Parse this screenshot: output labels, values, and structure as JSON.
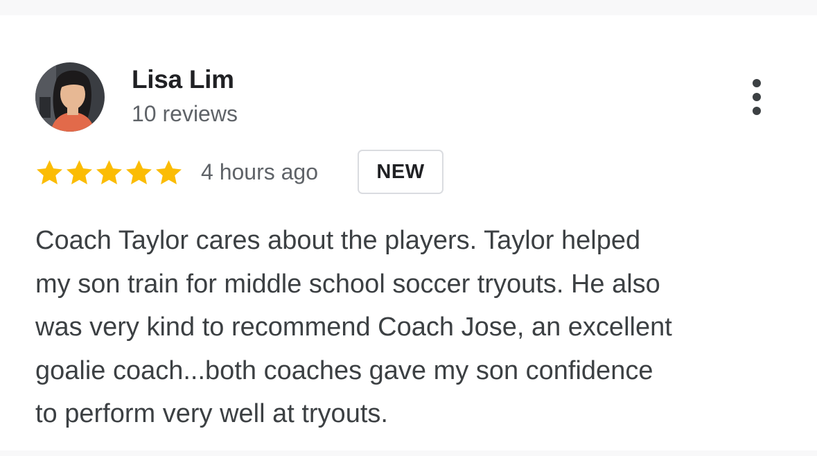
{
  "review": {
    "author": {
      "name": "Lisa Lim",
      "review_count": "10 reviews",
      "avatar_icon": "profile-photo"
    },
    "rating": 5,
    "max_rating": 5,
    "time_ago": "4 hours ago",
    "badge": "NEW",
    "text_lines": [
      "Coach Taylor cares about the players. Taylor helped",
      "my son train for middle school soccer tryouts. He also",
      "was very kind to recommend Coach Jose, an excellent",
      "goalie coach...both coaches gave my son confidence",
      "to perform very well at tryouts."
    ],
    "more_icon": "more-vert-icon"
  },
  "colors": {
    "star": "#fbbc04",
    "name": "#202124",
    "secondary": "#5f6368",
    "body_text": "#3c4043",
    "badge_border": "#dadce0"
  }
}
